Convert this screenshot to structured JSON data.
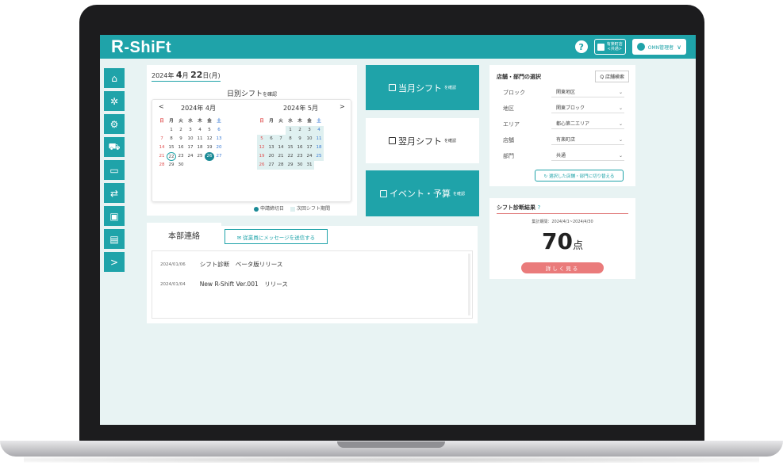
{
  "app": {
    "logo_r": "R",
    "logo_rest": "-ShiFt"
  },
  "topbar": {
    "help": "?",
    "store_line1": "有楽町店",
    "store_line2": "<共通>",
    "user": "OMN管理者",
    "chevron": "∨"
  },
  "sidebar": {
    "items": [
      {
        "icon": "home-icon",
        "glyph": "⌂"
      },
      {
        "icon": "gear-icon",
        "glyph": "✲"
      },
      {
        "icon": "settings-icon",
        "glyph": "⚙"
      },
      {
        "icon": "cart-icon",
        "glyph": "⛟"
      },
      {
        "icon": "folder-icon",
        "glyph": "▭"
      },
      {
        "icon": "swap-icon",
        "glyph": "⇄"
      },
      {
        "icon": "monitor-icon",
        "glyph": "▣"
      },
      {
        "icon": "book-icon",
        "glyph": "▤"
      },
      {
        "icon": "expand-icon",
        "glyph": ">"
      }
    ]
  },
  "calendar": {
    "date_prefix": "2024年",
    "date_month": "4",
    "date_month_suffix": "月",
    "date_day": "22",
    "date_suffix": "日(月)",
    "daily_link": "日別シフト",
    "daily_link_small": "を確認",
    "prev": "<",
    "next": ">",
    "month1": "2024年 4月",
    "month2": "2024年 5月",
    "weekdays": [
      "日",
      "月",
      "火",
      "水",
      "木",
      "金",
      "土"
    ],
    "april": [
      "",
      "1",
      "2",
      "3",
      "4",
      "5",
      "6",
      "7",
      "8",
      "9",
      "10",
      "11",
      "12",
      "13",
      "14",
      "15",
      "16",
      "17",
      "18",
      "19",
      "20",
      "21",
      "22",
      "23",
      "24",
      "25",
      "26",
      "27",
      "28",
      "29",
      "30"
    ],
    "may": [
      "",
      "",
      "",
      "1",
      "2",
      "3",
      "4",
      "5",
      "6",
      "7",
      "8",
      "9",
      "10",
      "11",
      "12",
      "13",
      "14",
      "15",
      "16",
      "17",
      "18",
      "19",
      "20",
      "21",
      "22",
      "23",
      "24",
      "25",
      "26",
      "27",
      "28",
      "29",
      "30",
      "31"
    ],
    "today": "22",
    "selected": "26",
    "legend_deadline": "申請締切日",
    "legend_period": "次回シフト期間"
  },
  "buttons": {
    "current_month": "当月シフト",
    "current_month_small": "を確認",
    "next_month": "翌月シフト",
    "next_month_small": "を確認",
    "events": "イベント・予算",
    "events_small": "を確認"
  },
  "store_select": {
    "title": "店舗・部門の選択",
    "search": "Q 店舗検索",
    "rows": [
      {
        "label": "ブロック",
        "value": "関東地区"
      },
      {
        "label": "地区",
        "value": "関東ブロック"
      },
      {
        "label": "エリア",
        "value": "都心第二エリア"
      },
      {
        "label": "店舗",
        "value": "有楽町店"
      },
      {
        "label": "部門",
        "value": "共通"
      }
    ],
    "arrow": "⌄",
    "switch": "↻ 選択した店舗・部門に切り替える"
  },
  "diagnosis": {
    "title": "シフト診断結果",
    "help": "?",
    "period": "集計期間：2024/4/1~2024/4/30",
    "score": "70",
    "unit": "点",
    "detail": "詳しく見る"
  },
  "hq": {
    "tab": "本部連絡",
    "send_btn": "✉ 従業員にメッセージを送信する",
    "news": [
      {
        "date": "2024/01/06",
        "text": "シフト診断　ベータ版リリース"
      },
      {
        "date": "2024/01/04",
        "text": "New R-Shift Ver.001　リリース"
      }
    ]
  }
}
